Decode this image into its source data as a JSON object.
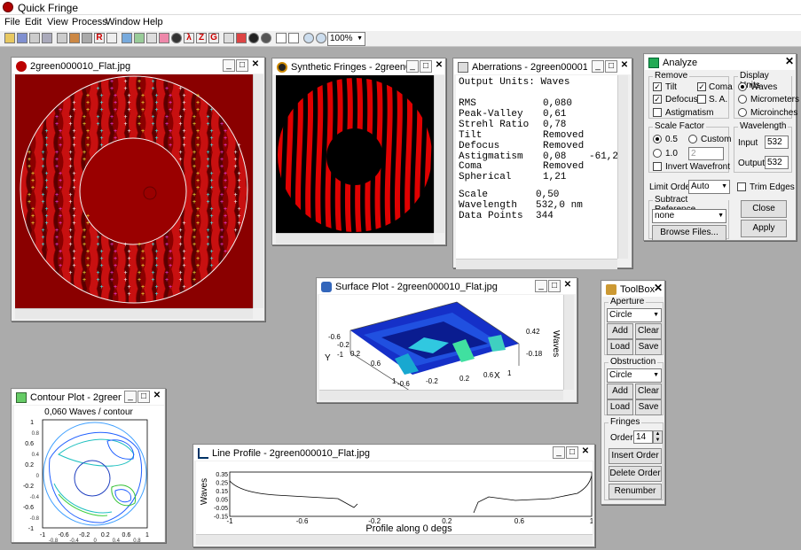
{
  "app": {
    "title": "Quick Fringe"
  },
  "menu": [
    "File",
    "Edit",
    "View",
    "Process",
    "Window",
    "Help"
  ],
  "toolbar": {
    "zoom": "100%"
  },
  "windows": {
    "interferogram": {
      "title": "2green000010_Flat.jpg"
    },
    "synthetic": {
      "title": "Synthetic Fringes - 2green000010_Flat.jpg"
    },
    "aberrations": {
      "title": "Aberrations - 2green000010_Flat.jpg",
      "units_label": "Output Units:",
      "units": "Waves",
      "rows": [
        {
          "name": "RMS",
          "value": "0,080",
          "extra": ""
        },
        {
          "name": "Peak-Valley",
          "value": "0,61",
          "extra": ""
        },
        {
          "name": "Strehl Ratio",
          "value": "0,78",
          "extra": ""
        },
        {
          "name": "Tilt",
          "value": "Removed",
          "extra": ""
        },
        {
          "name": "Defocus",
          "value": "Removed",
          "extra": ""
        },
        {
          "name": "Astigmatism",
          "value": "0,08",
          "extra": "-61,2"
        },
        {
          "name": "Coma",
          "value": "Removed",
          "extra": ""
        },
        {
          "name": "Spherical",
          "value": "1,21",
          "extra": ""
        }
      ],
      "rows2": [
        {
          "name": "Scale",
          "value": "0,50"
        },
        {
          "name": "Wavelength",
          "value": "532,0 nm"
        },
        {
          "name": "Data Points",
          "value": "344"
        }
      ]
    },
    "surface": {
      "title": "Surface Plot - 2green000010_Flat.jpg",
      "ticks_x": [
        "-0.6",
        "-0.2",
        "0.2",
        "0.6",
        "1"
      ],
      "ticks_y": [
        "1",
        "0.6",
        "0.2",
        "-0.2",
        "-0.6"
      ],
      "ytick_near": "-1",
      "z_top": "0.42",
      "z_bot": "-0.18",
      "x_label": "X",
      "y_label": "Y",
      "z_label": "Waves"
    },
    "contour": {
      "title": "Contour Plot - 2green000010_Flat.jpg",
      "heading": "0,060 Waves / contour",
      "yticks": [
        "1",
        "0.6",
        "0.2",
        "-0.2",
        "-0.6",
        "-1"
      ],
      "yticks_small": [
        "0.8",
        "0.4",
        "0",
        "-0.4",
        "-0.8"
      ],
      "xticks": [
        "-1",
        "-0.6",
        "-0.2",
        "0.2",
        "0.6",
        "1"
      ],
      "xticks_small": [
        "-0.8",
        "-0.4",
        "0",
        "0.4",
        "0.8"
      ]
    },
    "line_profile": {
      "title": "Line Profile - 2green000010_Flat.jpg",
      "ylabel": "Waves",
      "xlabel": "Profile along 0 degs",
      "yticks": [
        "0.35",
        "0.25",
        "0.15",
        "0.05",
        "-0.05",
        "-0.15"
      ],
      "xticks": [
        "-1",
        "-0.6",
        "-0.2",
        "0.2",
        "0.6",
        "1"
      ]
    }
  },
  "analyze": {
    "title": "Analyze",
    "remove": {
      "label": "Remove",
      "tilt": "Tilt",
      "coma": "Coma",
      "defocus": "Defocus",
      "sa": "S. A.",
      "astig": "Astigmatism",
      "check": "✓"
    },
    "display_units": {
      "label": "Display Units",
      "waves": "Waves",
      "micrometers": "Micrometers",
      "microinches": "Microinches"
    },
    "scale_factor": {
      "label": "Scale Factor",
      "v05": "0.5",
      "custom": "Custom",
      "v10": "1.0",
      "custom_value": "2",
      "invert": "Invert Wavefront"
    },
    "wavelength": {
      "label": "Wavelength",
      "input_label": "Input",
      "input": "532",
      "output_label": "Output",
      "output": "532"
    },
    "limit_order": {
      "label": "Limit Order",
      "value": "Auto"
    },
    "trim": "Trim Edges",
    "subtract": {
      "label": "Subtract Reference",
      "value": "none",
      "browse": "Browse Files..."
    },
    "close": "Close",
    "apply": "Apply"
  },
  "toolbox": {
    "title": "ToolBox",
    "aperture": {
      "label": "Aperture",
      "shape": "Circle",
      "add": "Add",
      "clear": "Clear",
      "load": "Load",
      "save": "Save"
    },
    "obstruction": {
      "label": "Obstruction",
      "shape": "Circle",
      "add": "Add",
      "clear": "Clear",
      "load": "Load",
      "save": "Save"
    },
    "fringes": {
      "label": "Fringes",
      "order_label": "Order",
      "order": "14",
      "insert": "Insert Order",
      "delete": "Delete Order",
      "renumber": "Renumber"
    }
  },
  "colors": {
    "fringe_red": "#c81010",
    "fringe_dark": "#5a0000",
    "mdi_bg": "#ababab"
  }
}
